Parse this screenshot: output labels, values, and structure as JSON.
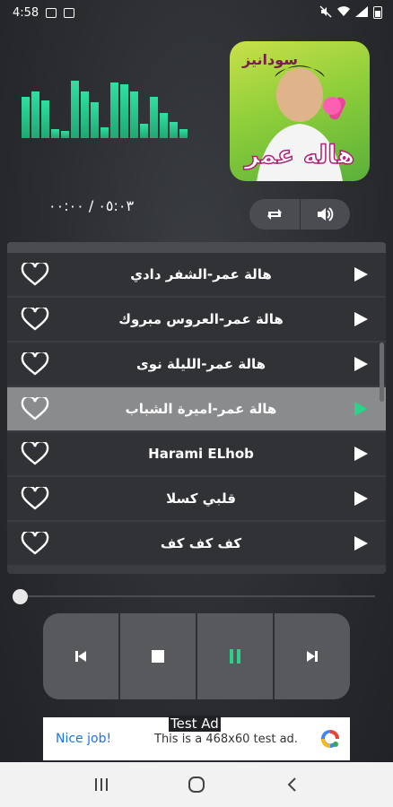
{
  "status": {
    "time": "4:58",
    "icons": [
      "image-icon",
      "screenshot-icon",
      "mute-icon",
      "wifi-icon",
      "signal-icon",
      "battery-icon"
    ]
  },
  "player": {
    "time_display": "٠٥:٠٣ / ٠٠:٠٠",
    "album_art_text": "سودانيز",
    "album_artist": "هاله عمر",
    "accent_color": "#2ed18a"
  },
  "playlist": {
    "tracks": [
      {
        "title": "هالة عمر-الشفر دادي",
        "active": false
      },
      {
        "title": "هالة عمر-العروس مبروك",
        "active": false
      },
      {
        "title": "هالة عمر-الليلة نوى",
        "active": false
      },
      {
        "title": "هالة عمر-اميرة الشباب",
        "active": true
      },
      {
        "title": "Harami ELhob",
        "active": false
      },
      {
        "title": "قلبي كسلا",
        "active": false
      },
      {
        "title": "كف كف كف",
        "active": false
      }
    ]
  },
  "seek": {
    "progress": 0
  },
  "ad": {
    "label": "Test Ad",
    "nice": "Nice job!",
    "text": "This is a 468x60 test ad."
  }
}
